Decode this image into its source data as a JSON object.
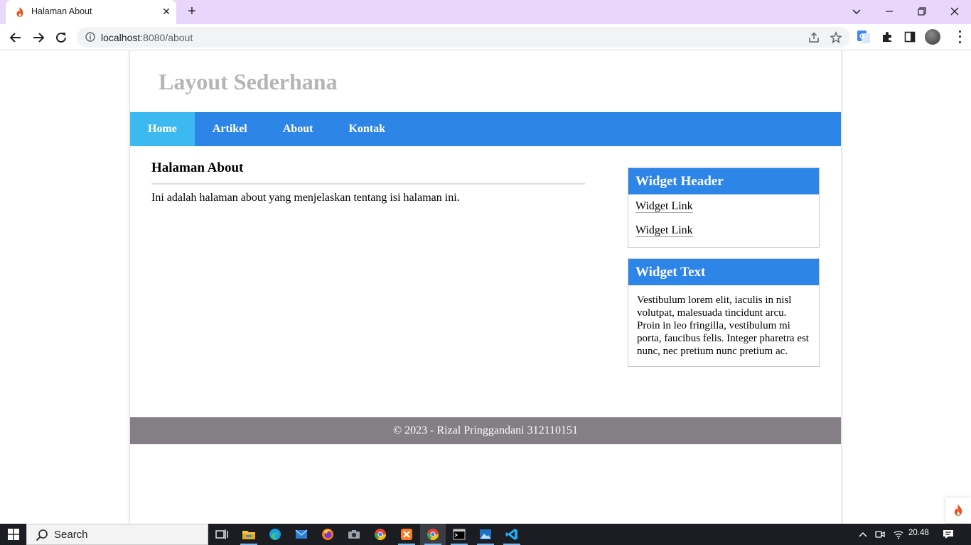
{
  "browser": {
    "tab_title": "Halaman About",
    "url_host": "localhost",
    "url_rest": ":8080/about"
  },
  "page": {
    "site_title": "Layout Sederhana",
    "nav": [
      {
        "label": "Home",
        "active": true
      },
      {
        "label": "Artikel",
        "active": false
      },
      {
        "label": "About",
        "active": false
      },
      {
        "label": "Kontak",
        "active": false
      }
    ],
    "main": {
      "title": "Halaman About",
      "text": "Ini adalah halaman about yang menjelaskan tentang isi halaman ini."
    },
    "widgets": {
      "links_header": "Widget Header",
      "links": [
        "Widget Link",
        "Widget Link"
      ],
      "text_header": "Widget Text",
      "text_body": "Vestibulum lorem elit, iaculis in nisl volutpat, malesuada tincidunt arcu. Proin in leo fringilla, vestibulum mi porta, faucibus felis. Integer pharetra est nunc, nec pretium nunc pretium ac."
    },
    "footer": "© 2023 - Rizal Pringgandani 312110151"
  },
  "taskbar": {
    "search_label": "Search",
    "time": "20.48"
  },
  "colors": {
    "tabstrip": "#e9d7fb",
    "nav_bg": "#2e85e8",
    "nav_active": "#3db9f1",
    "footer_bg": "#847e85",
    "site_title": "#b5b5b5"
  }
}
